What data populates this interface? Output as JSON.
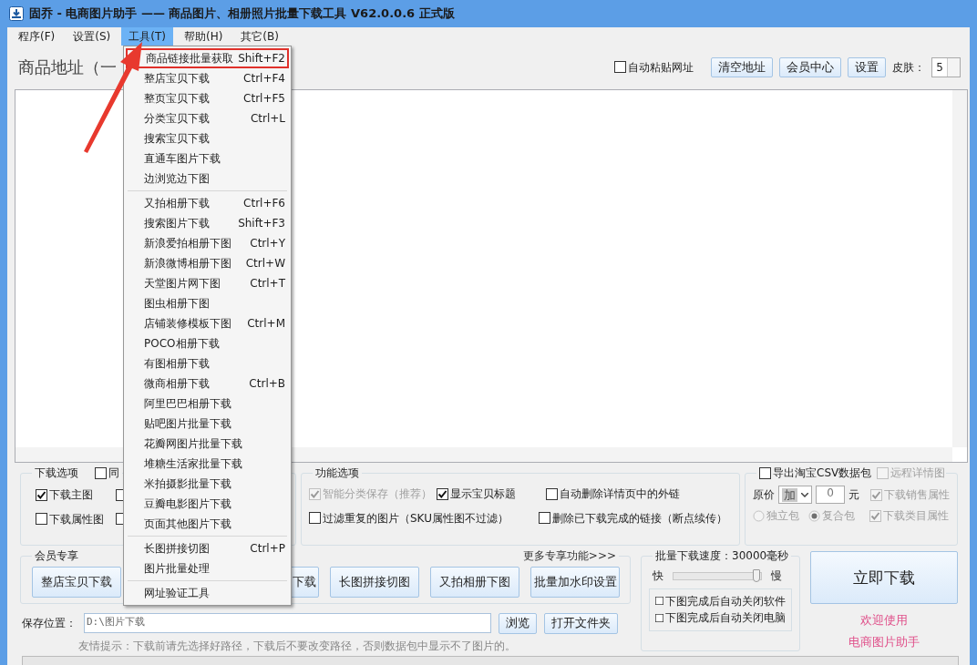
{
  "window": {
    "title": "固乔 - 电商图片助手 —— 商品图片、相册照片批量下载工具 V62.0.0.6 正式版"
  },
  "menu_bar": [
    {
      "label": "程序(F)",
      "selected": false
    },
    {
      "label": "设置(S)",
      "selected": false
    },
    {
      "label": "工具(T)",
      "selected": true
    },
    {
      "label": "帮助(H)",
      "selected": false
    },
    {
      "label": "其它(B)",
      "selected": false
    }
  ],
  "address": {
    "label": "商品地址（一",
    "auto_paste": {
      "label": "自动粘贴网址",
      "checked": false
    },
    "buttons": [
      "清空地址",
      "会员中心",
      "设置"
    ],
    "skin": {
      "label": "皮肤：",
      "value": "5"
    }
  },
  "download_options": {
    "title": "下载选项",
    "header_option": {
      "label": "同",
      "checked": false
    },
    "options": [
      {
        "label": "下载主图",
        "checked": true
      },
      {
        "checked": false
      },
      {
        "label": "下载属性图",
        "checked": false
      },
      {
        "checked": false
      }
    ]
  },
  "function_options": {
    "title": "功能选项",
    "options": [
      {
        "label": "智能分类保存（推荐）",
        "checked": true,
        "disabled": true
      },
      {
        "label": "显示宝贝标题",
        "checked": true,
        "disabled": false
      },
      {
        "label": "自动删除详情页中的外链",
        "checked": false,
        "disabled": false
      },
      {
        "label": "过滤重复的图片（SKU属性图不过滤）",
        "checked": false,
        "disabled": false
      },
      {
        "label": "删除已下载完成的链接（断点续传）",
        "checked": false,
        "disabled": false
      }
    ]
  },
  "csv_export": {
    "export": {
      "label": "导出淘宝CSV数据包",
      "checked": false,
      "disabled": false
    },
    "remote_detail": {
      "label": "远程详情图",
      "checked": false,
      "disabled": true
    },
    "price_label": "原价",
    "price_op": "加",
    "price_value": "0",
    "currency": "元",
    "sales_attr": {
      "label": "下载销售属性",
      "checked": true,
      "disabled": true
    },
    "packages": [
      {
        "label": "独立包",
        "selected": false,
        "disabled": true
      },
      {
        "label": "复合包",
        "selected": true,
        "disabled": true
      }
    ],
    "category_attr": {
      "label": "下载类目属性",
      "checked": true,
      "disabled": true
    }
  },
  "member": {
    "title": "会员专享",
    "more_link": "更多专享功能>>>",
    "buttons": [
      "整店宝贝下载",
      "下载",
      "长图拼接切图",
      "又拍相册下图",
      "批量加水印设置"
    ]
  },
  "speed": {
    "title": "批量下载速度：30000毫秒",
    "fast": "快",
    "slow": "慢",
    "level": 0.97,
    "close_options": [
      {
        "label": "下图完成后自动关闭软件",
        "checked": false
      },
      {
        "label": "下图完成后自动关闭电脑",
        "checked": false
      }
    ]
  },
  "start_button": "立即下载",
  "welcome": [
    "欢迎使用",
    "电商图片助手"
  ],
  "save": {
    "label": "保存位置：",
    "path": "D:\\图片下载",
    "buttons": [
      "浏览",
      "打开文件夹"
    ],
    "hint": "友情提示：下载前请先选择好路径，下载后不要改变路径，否则数据包中显示不了图片的。"
  },
  "progress": {
    "level": 0
  },
  "tools_menu": {
    "groups": [
      [
        {
          "label": "商品链接批量获取",
          "shortcut": "Shift+F2",
          "highlighted": true
        },
        {
          "label": "整店宝贝下载",
          "shortcut": "Ctrl+F4",
          "highlighted": false
        },
        {
          "label": "整页宝贝下载",
          "shortcut": "Ctrl+F5",
          "highlighted": false
        },
        {
          "label": "分类宝贝下载",
          "shortcut": "Ctrl+L",
          "highlighted": false
        },
        {
          "label": "搜索宝贝下载",
          "highlighted": false
        },
        {
          "label": "直通车图片下载",
          "highlighted": false
        },
        {
          "label": "边浏览边下图",
          "highlighted": false
        }
      ],
      [
        {
          "label": "又拍相册下载",
          "shortcut": "Ctrl+F6",
          "highlighted": false
        },
        {
          "label": "搜索图片下载",
          "shortcut": "Shift+F3",
          "highlighted": false
        },
        {
          "label": "新浪爱拍相册下图",
          "shortcut": "Ctrl+Y",
          "highlighted": false
        },
        {
          "label": "新浪微博相册下图",
          "shortcut": "Ctrl+W",
          "highlighted": false
        },
        {
          "label": "天堂图片网下图",
          "shortcut": "Ctrl+T",
          "highlighted": false
        },
        {
          "label": "图虫相册下图",
          "highlighted": false
        },
        {
          "label": "店铺装修模板下图",
          "shortcut": "Ctrl+M",
          "highlighted": false
        },
        {
          "label": "POCO相册下载",
          "highlighted": false
        },
        {
          "label": "有图相册下载",
          "highlighted": false
        },
        {
          "label": "微商相册下载",
          "shortcut": "Ctrl+B",
          "highlighted": false
        },
        {
          "label": "阿里巴巴相册下载",
          "highlighted": false
        },
        {
          "label": "贴吧图片批量下载",
          "highlighted": false
        },
        {
          "label": "花瓣网图片批量下载",
          "highlighted": false
        },
        {
          "label": "堆糖生活家批量下载",
          "highlighted": false
        },
        {
          "label": "米拍摄影批量下载",
          "highlighted": false
        },
        {
          "label": "豆瓣电影图片下载",
          "highlighted": false
        },
        {
          "label": "页面其他图片下载",
          "highlighted": false
        }
      ],
      [
        {
          "label": "长图拼接切图",
          "shortcut": "Ctrl+P",
          "highlighted": false
        },
        {
          "label": "图片批量处理",
          "highlighted": false
        }
      ],
      [
        {
          "label": "网址验证工具",
          "highlighted": false
        }
      ]
    ]
  }
}
